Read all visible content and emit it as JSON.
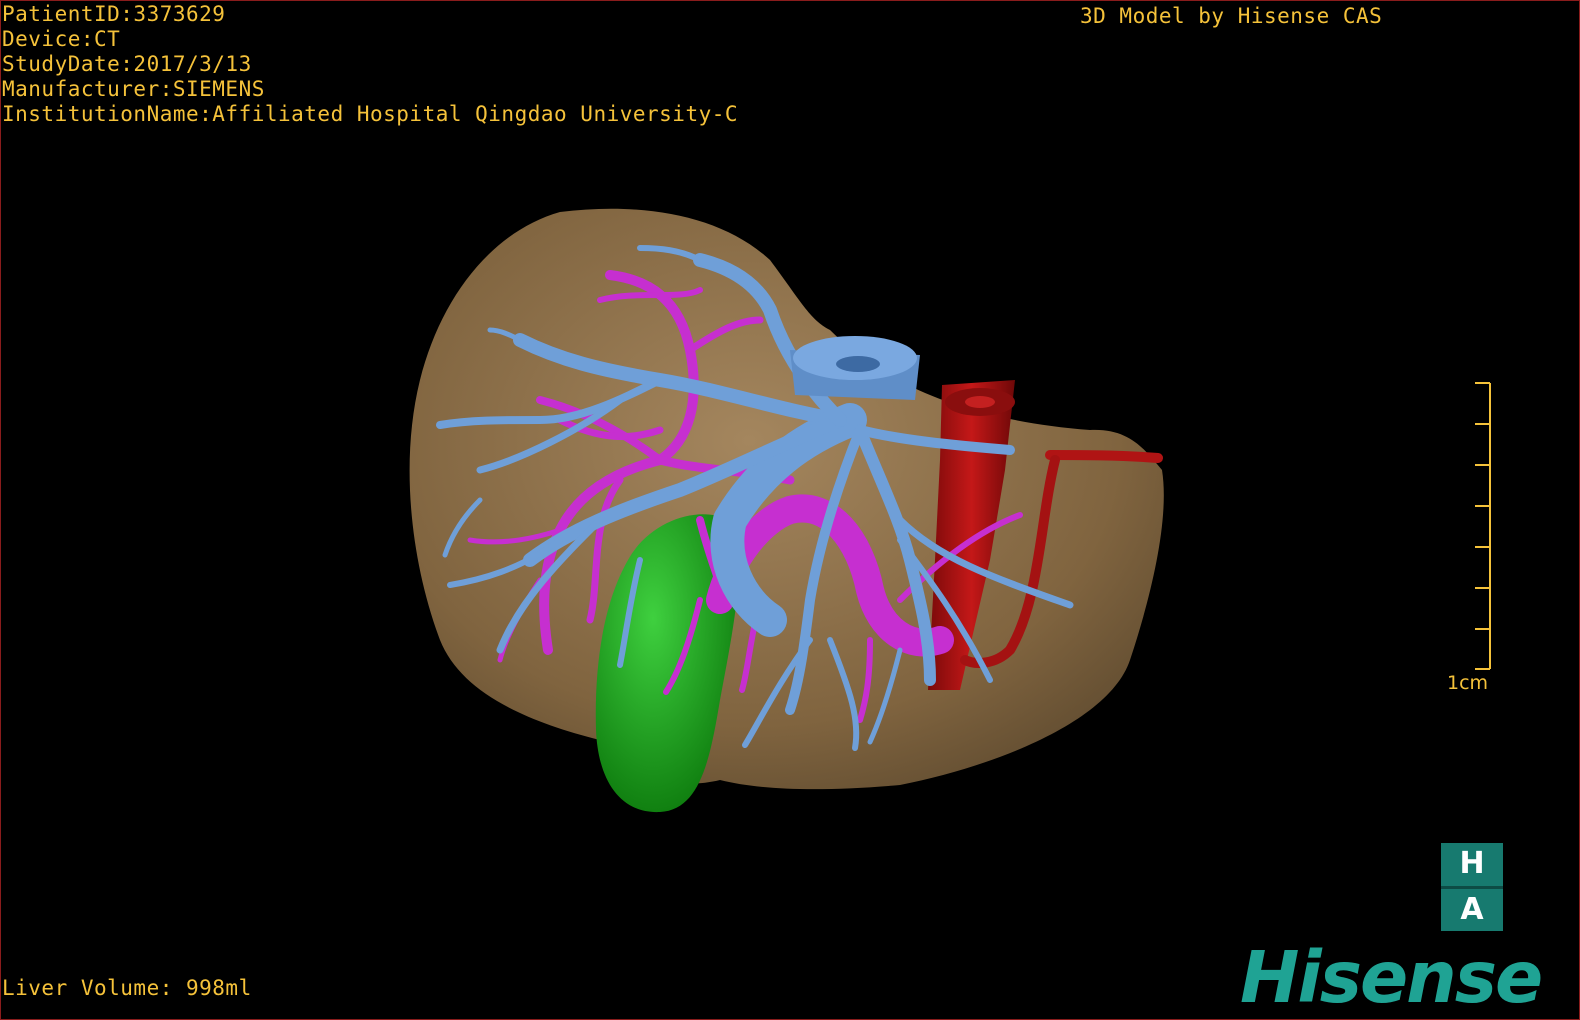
{
  "header": {
    "patient_id": "PatientID:3373629",
    "device": "Device:CT",
    "study_date": "StudyDate:2017/3/13",
    "manufacturer": "Manufacturer:SIEMENS",
    "institution": "InstitutionName:Affiliated Hospital Qingdao University-C"
  },
  "brand_caption": "3D Model by Hisense CAS",
  "footer": {
    "liver_volume": "Liver Volume: 998ml"
  },
  "scale_bar": {
    "label": "1cm"
  },
  "logos": {
    "ha_top": "H",
    "ha_bottom": "A",
    "hisense": "Hisense"
  },
  "colors": {
    "text": "#f5c23a",
    "liver": "#8a6e4b",
    "portal_vein": "#6f9fd8",
    "hepatic_artery": "#c62fd0",
    "gallbladder": "#1aa31a",
    "aorta": "#b01414",
    "brand": "#1fa394"
  }
}
